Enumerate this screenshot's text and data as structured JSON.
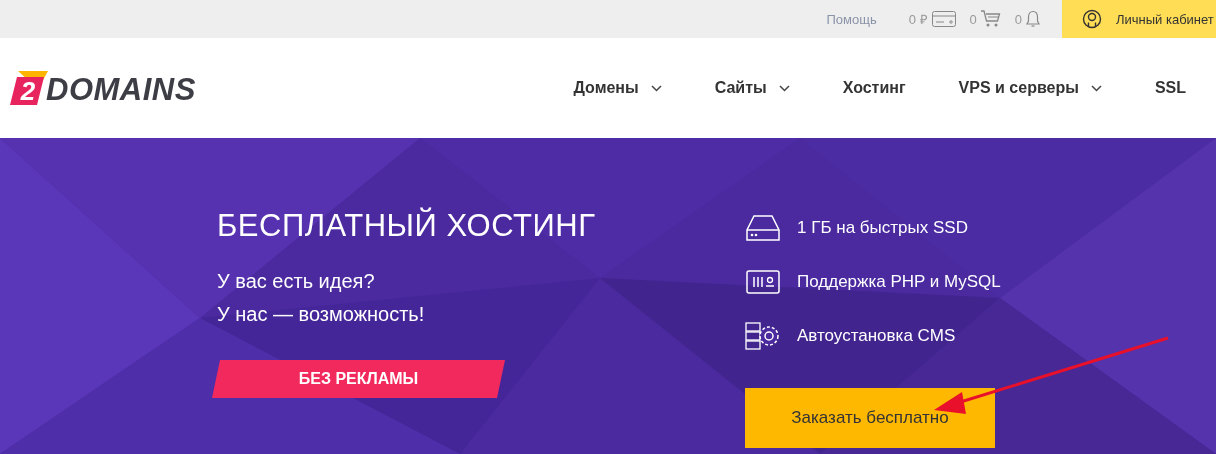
{
  "top_bar": {
    "help": "Помощь",
    "balance": "0 ₽",
    "cart_count": "0",
    "notifications_count": "0",
    "account": "Личный кабинет"
  },
  "logo": {
    "digit": "2",
    "word": "DOMAINS"
  },
  "nav": [
    {
      "label": "Домены",
      "dropdown": true
    },
    {
      "label": "Сайты",
      "dropdown": true
    },
    {
      "label": "Хостинг",
      "dropdown": false
    },
    {
      "label": "VPS и серверы",
      "dropdown": true
    },
    {
      "label": "SSL",
      "dropdown": false
    }
  ],
  "hero": {
    "title": "БЕСПЛАТНЫЙ ХОСТИНГ",
    "lines": [
      "У вас есть идея?",
      "У нас — возможность!"
    ],
    "badge": "БЕЗ РЕКЛАМЫ",
    "features": [
      {
        "kind": "drive",
        "text": "1 ГБ на быстрых SSD"
      },
      {
        "kind": "server",
        "text": "Поддержка PHP и MySQL"
      },
      {
        "kind": "gear",
        "text": "Автоустановка CMS"
      }
    ],
    "order_button": "Заказать бесплатно"
  }
}
